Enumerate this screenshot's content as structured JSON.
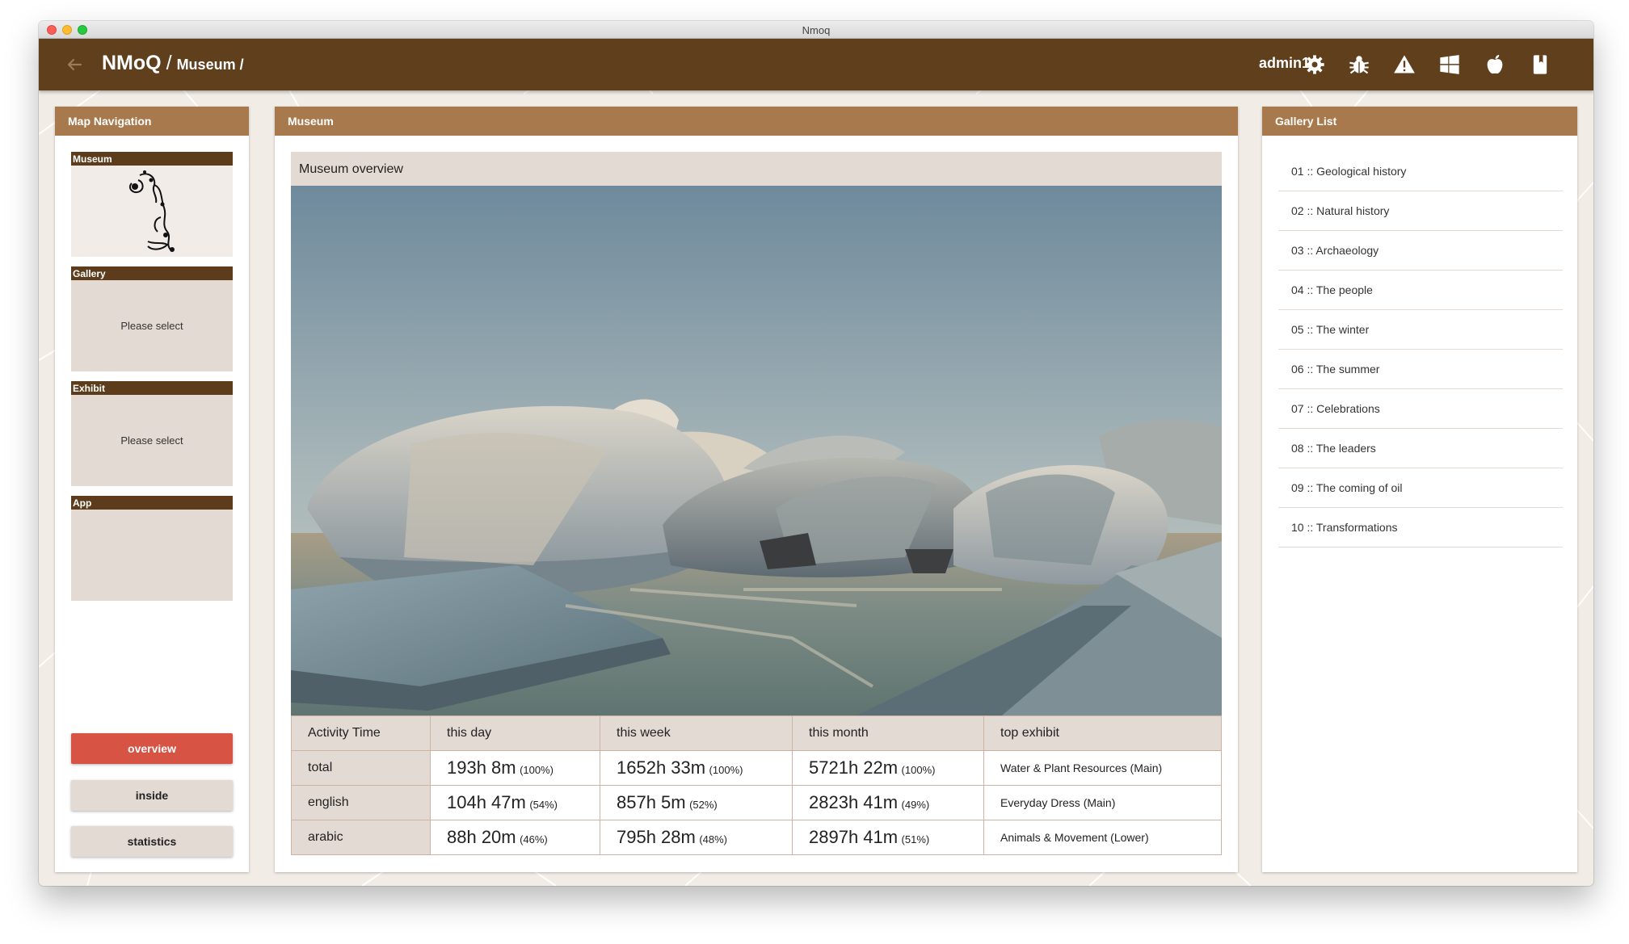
{
  "window": {
    "title": "Nmoq"
  },
  "header": {
    "breadcrumb_main": "NMoQ",
    "separator": "/",
    "breadcrumb_sub": "Museum /",
    "user": "admin1",
    "icons": [
      "gear-icon",
      "bug-icon",
      "warning-icon",
      "windows-icon",
      "apple-icon",
      "book-icon"
    ]
  },
  "map_navigation": {
    "title": "Map Navigation",
    "boxes": [
      {
        "label": "Museum",
        "body": ""
      },
      {
        "label": "Gallery",
        "body": "Please select"
      },
      {
        "label": "Exhibit",
        "body": "Please select"
      },
      {
        "label": "App",
        "body": ""
      }
    ],
    "buttons": [
      {
        "label": "overview",
        "active": true
      },
      {
        "label": "inside",
        "active": false
      },
      {
        "label": "statistics",
        "active": false
      }
    ]
  },
  "museum": {
    "title": "Museum",
    "overview_title": "Museum overview",
    "table": {
      "headers": [
        "Activity Time",
        "this day",
        "this week",
        "this month",
        "top exhibit"
      ],
      "rows": [
        {
          "label": "total",
          "day": "193h 8m",
          "day_pct": "(100%)",
          "week": "1652h 33m",
          "week_pct": "(100%)",
          "month": "5721h 22m",
          "month_pct": "(100%)",
          "top": "Water & Plant Resources (Main)"
        },
        {
          "label": "english",
          "day": "104h 47m",
          "day_pct": "(54%)",
          "week": "857h 5m",
          "week_pct": "(52%)",
          "month": "2823h 41m",
          "month_pct": "(49%)",
          "top": "Everyday Dress (Main)"
        },
        {
          "label": "arabic",
          "day": "88h 20m",
          "day_pct": "(46%)",
          "week": "795h 28m",
          "week_pct": "(48%)",
          "month": "2897h 41m",
          "month_pct": "(51%)",
          "top": "Animals & Movement (Lower)"
        }
      ]
    }
  },
  "gallery_list": {
    "title": "Gallery List",
    "items": [
      "01 :: Geological history",
      "02 :: Natural history",
      "03 :: Archaeology",
      "04 :: The people",
      "05 :: The winter",
      "06 :: The summer",
      "07 :: Celebrations",
      "08 :: The leaders",
      "09 :: The coming of oil",
      "10 :: Transformations"
    ]
  },
  "colors": {
    "header": "#5f3f1c",
    "panel_head": "#a8794c",
    "active_button": "#d75344",
    "box_bg": "#e3dad4"
  }
}
